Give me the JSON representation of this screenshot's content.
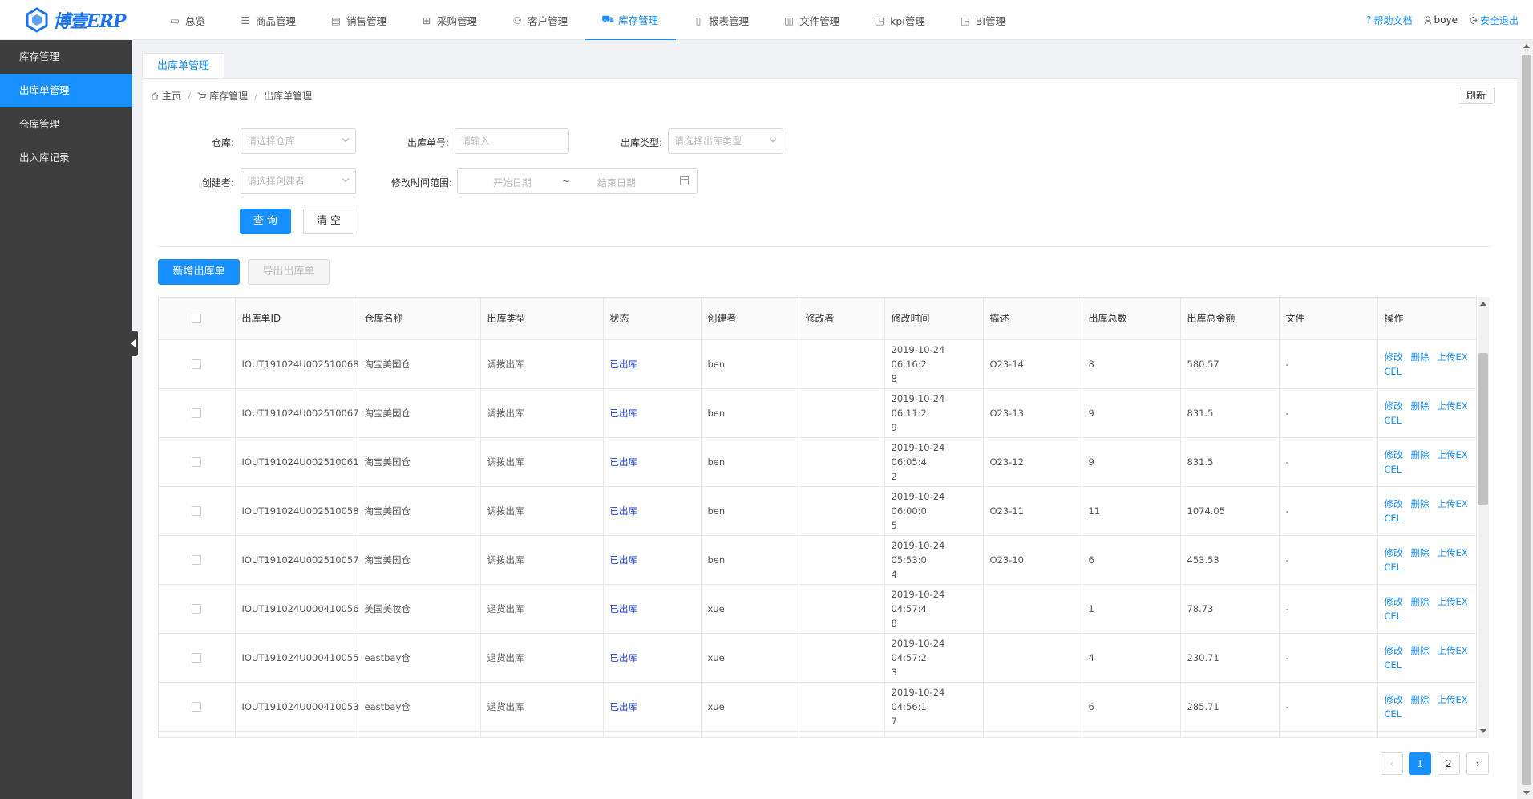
{
  "app": {
    "logo_text": "博壹ERP"
  },
  "nav": [
    {
      "label": "总览",
      "icon": "monitor-icon"
    },
    {
      "label": "商品管理",
      "icon": "list-icon"
    },
    {
      "label": "销售管理",
      "icon": "doc-icon"
    },
    {
      "label": "采购管理",
      "icon": "grid-icon"
    },
    {
      "label": "客户管理",
      "icon": "user-icon"
    },
    {
      "label": "库存管理",
      "icon": "cart-icon",
      "active": true
    },
    {
      "label": "报表管理",
      "icon": "file-icon"
    },
    {
      "label": "文件管理",
      "icon": "folder-icon"
    },
    {
      "label": "kpi管理",
      "icon": "chart-icon"
    },
    {
      "label": "BI管理",
      "icon": "bi-icon"
    }
  ],
  "topright": {
    "help": "帮助文档",
    "user": "boye",
    "logout": "安全退出"
  },
  "sidebar": [
    {
      "label": "库存管理"
    },
    {
      "label": "出库单管理",
      "active": true
    },
    {
      "label": "仓库管理"
    },
    {
      "label": "出入库记录"
    }
  ],
  "tab": {
    "label": "出库单管理"
  },
  "breadcrumb": {
    "home": "主页",
    "level1": "库存管理",
    "level2": "出库单管理"
  },
  "refresh_label": "刷新",
  "filters": {
    "warehouse_label": "仓库:",
    "warehouse_placeholder": "请选择仓库",
    "order_no_label": "出库单号:",
    "order_no_placeholder": "请输入",
    "type_label": "出库类型:",
    "type_placeholder": "请选择出库类型",
    "creator_label": "创建者:",
    "creator_placeholder": "请选择创建者",
    "time_label": "修改时间范围:",
    "start_placeholder": "开始日期",
    "range_sep": "~",
    "end_placeholder": "结束日期"
  },
  "buttons": {
    "query": "查 询",
    "clear": "清 空",
    "add": "新增出库单",
    "export": "导出出库单"
  },
  "table": {
    "columns": [
      "出库单ID",
      "仓库名称",
      "出库类型",
      "状态",
      "创建者",
      "修改者",
      "修改时间",
      "描述",
      "出库总数",
      "出库总金额",
      "文件",
      "操作"
    ],
    "rows": [
      {
        "id": "IOUT191024U002510068",
        "warehouse": "淘宝美国仓",
        "type": "调拨出库",
        "status": "已出库",
        "creator": "ben",
        "modifier": "",
        "time1": "2019-10-24 06:16:2",
        "time2": "8",
        "desc": "O23-14",
        "count": "8",
        "amount": "580.57",
        "file": "-"
      },
      {
        "id": "IOUT191024U002510067",
        "warehouse": "淘宝美国仓",
        "type": "调拨出库",
        "status": "已出库",
        "creator": "ben",
        "modifier": "",
        "time1": "2019-10-24 06:11:2",
        "time2": "9",
        "desc": "O23-13",
        "count": "9",
        "amount": "831.5",
        "file": "-"
      },
      {
        "id": "IOUT191024U002510061",
        "warehouse": "淘宝美国仓",
        "type": "调拨出库",
        "status": "已出库",
        "creator": "ben",
        "modifier": "",
        "time1": "2019-10-24 06:05:4",
        "time2": "2",
        "desc": "O23-12",
        "count": "9",
        "amount": "831.5",
        "file": "-"
      },
      {
        "id": "IOUT191024U002510058",
        "warehouse": "淘宝美国仓",
        "type": "调拨出库",
        "status": "已出库",
        "creator": "ben",
        "modifier": "",
        "time1": "2019-10-24 06:00:0",
        "time2": "5",
        "desc": "O23-11",
        "count": "11",
        "amount": "1074.05",
        "file": "-"
      },
      {
        "id": "IOUT191024U002510057",
        "warehouse": "淘宝美国仓",
        "type": "调拨出库",
        "status": "已出库",
        "creator": "ben",
        "modifier": "",
        "time1": "2019-10-24 05:53:0",
        "time2": "4",
        "desc": "O23-10",
        "count": "6",
        "amount": "453.53",
        "file": "-"
      },
      {
        "id": "IOUT191024U000410056",
        "warehouse": "美国美妆仓",
        "type": "退货出库",
        "status": "已出库",
        "creator": "xue",
        "modifier": "",
        "time1": "2019-10-24 04:57:4",
        "time2": "8",
        "desc": "",
        "count": "1",
        "amount": "78.73",
        "file": "-"
      },
      {
        "id": "IOUT191024U000410055",
        "warehouse": "eastbay仓",
        "type": "退货出库",
        "status": "已出库",
        "creator": "xue",
        "modifier": "",
        "time1": "2019-10-24 04:57:2",
        "time2": "3",
        "desc": "",
        "count": "4",
        "amount": "230.71",
        "file": "-"
      },
      {
        "id": "IOUT191024U000410053",
        "warehouse": "eastbay仓",
        "type": "退货出库",
        "status": "已出库",
        "creator": "xue",
        "modifier": "",
        "time1": "2019-10-24 04:56:1",
        "time2": "7",
        "desc": "",
        "count": "6",
        "amount": "285.71",
        "file": "-"
      }
    ],
    "ops": {
      "edit": "修改",
      "delete": "删除",
      "upload1": "上传EX",
      "upload2": "CEL"
    }
  },
  "pagination": {
    "prev": "‹",
    "pages": [
      "1",
      "2"
    ],
    "current": "1",
    "next": "›"
  }
}
